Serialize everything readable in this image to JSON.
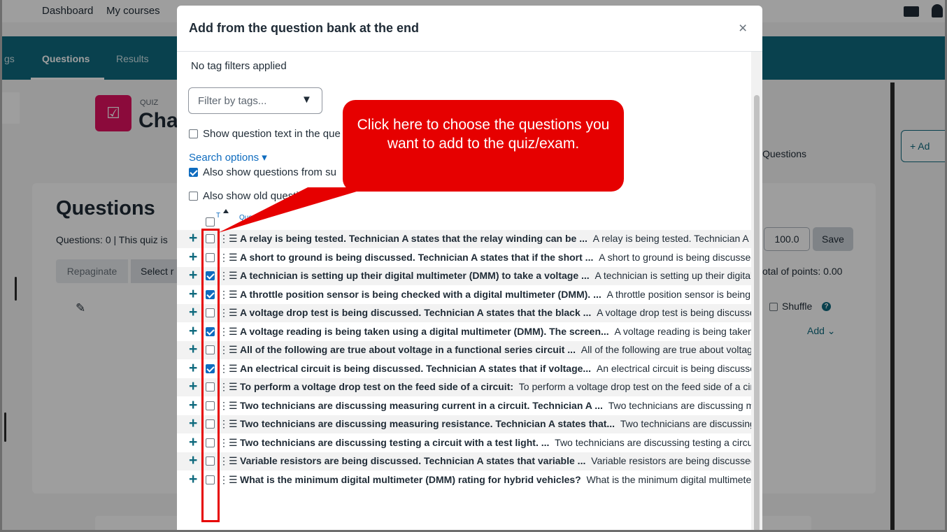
{
  "background": {
    "topbar": {
      "dashboard": "Dashboard",
      "my_courses": "My courses"
    },
    "navbar": {
      "settings_partial": "gs",
      "questions": "Questions",
      "results": "Results"
    },
    "quiz_label": "QUIZ",
    "quiz_name_partial": "Cha",
    "questions_heading": "Questions",
    "questions_info": "Questions: 0 | This quiz is",
    "repaginate": "Repaginate",
    "select_multiple_partial": "Select r",
    "max_grade": "100.0",
    "save": "Save",
    "total_points": "otal of points: 0.00",
    "shuffle": "Shuffle",
    "add": "Add ⌄",
    "questions_tab_partial": "Questions",
    "add_block_partial": "+  Ad"
  },
  "modal": {
    "title": "Add from the question bank at the end",
    "close": "×",
    "tag_status": "No tag filters applied",
    "tag_filter_placeholder": "Filter by tags...",
    "options": {
      "show_text": "Show question text in the que",
      "search_options": "Search options ▾",
      "also_subcategories": "Also show questions from su",
      "also_old": "Also show old questio"
    },
    "table_header": {
      "type_sort": "T",
      "question": "Questi"
    },
    "rows": [
      {
        "name": "A relay is being tested. Technician A states that the relay winding can be ...",
        "preview": "A relay is being tested. Technician A states that the relay winding can be",
        "checked": false
      },
      {
        "name": "A short to ground is being discussed. Technician A states that if the short ...",
        "preview": "A short to ground is being discussed.",
        "checked": false
      },
      {
        "name": "A technician is setting up their digital multimeter (DMM) to take a voltage ...",
        "preview": "A technician is setting up their digital",
        "checked": true
      },
      {
        "name": "A throttle position sensor is being checked with a digital multimeter (DMM). ...",
        "preview": "A throttle position sensor is being",
        "checked": true
      },
      {
        "name": "A voltage drop test is being discussed. Technician A states that the black ...",
        "preview": "A voltage drop test is being discussed.",
        "checked": false
      },
      {
        "name": "A voltage reading is being taken using a digital multimeter (DMM). The screen...",
        "preview": "A voltage reading is being taken",
        "checked": true
      },
      {
        "name": "All of the following are true about voltage in a functional series circuit ...",
        "preview": "All of the following are true about voltage",
        "checked": false
      },
      {
        "name": "An electrical circuit is being discussed. Technician A states that if voltage...",
        "preview": "An electrical circuit is being discussed.",
        "checked": true
      },
      {
        "name": "To perform a voltage drop test on the feed side of a circuit:",
        "preview": "To perform a voltage drop test on the feed side of a circuit",
        "checked": false
      },
      {
        "name": "Two technicians are discussing measuring current in a circuit. Technician A ...",
        "preview": "Two technicians are discussing measuring",
        "checked": false
      },
      {
        "name": "Two technicians are discussing measuring resistance. Technician A states that...",
        "preview": "Two technicians are discussing measuring",
        "checked": false
      },
      {
        "name": "Two technicians are discussing testing a circuit with a test light. ...",
        "preview": "Two technicians are discussing testing a circuit",
        "checked": false
      },
      {
        "name": "Variable resistors are being discussed. Technician A states that variable ...",
        "preview": "Variable resistors are being discussed.",
        "checked": false
      },
      {
        "name": "What is the minimum digital multimeter (DMM) rating for hybrid vehicles?",
        "preview": "What is the minimum digital multimeter",
        "checked": false
      }
    ]
  },
  "annotation": {
    "callout_text": "Click here to choose the questions you want to add to the quiz/exam.",
    "color": "#e60000"
  },
  "colors": {
    "brand": "#0f6a7e",
    "link": "#0f6cbf",
    "checkbox_checked": "#0f6cbf"
  }
}
